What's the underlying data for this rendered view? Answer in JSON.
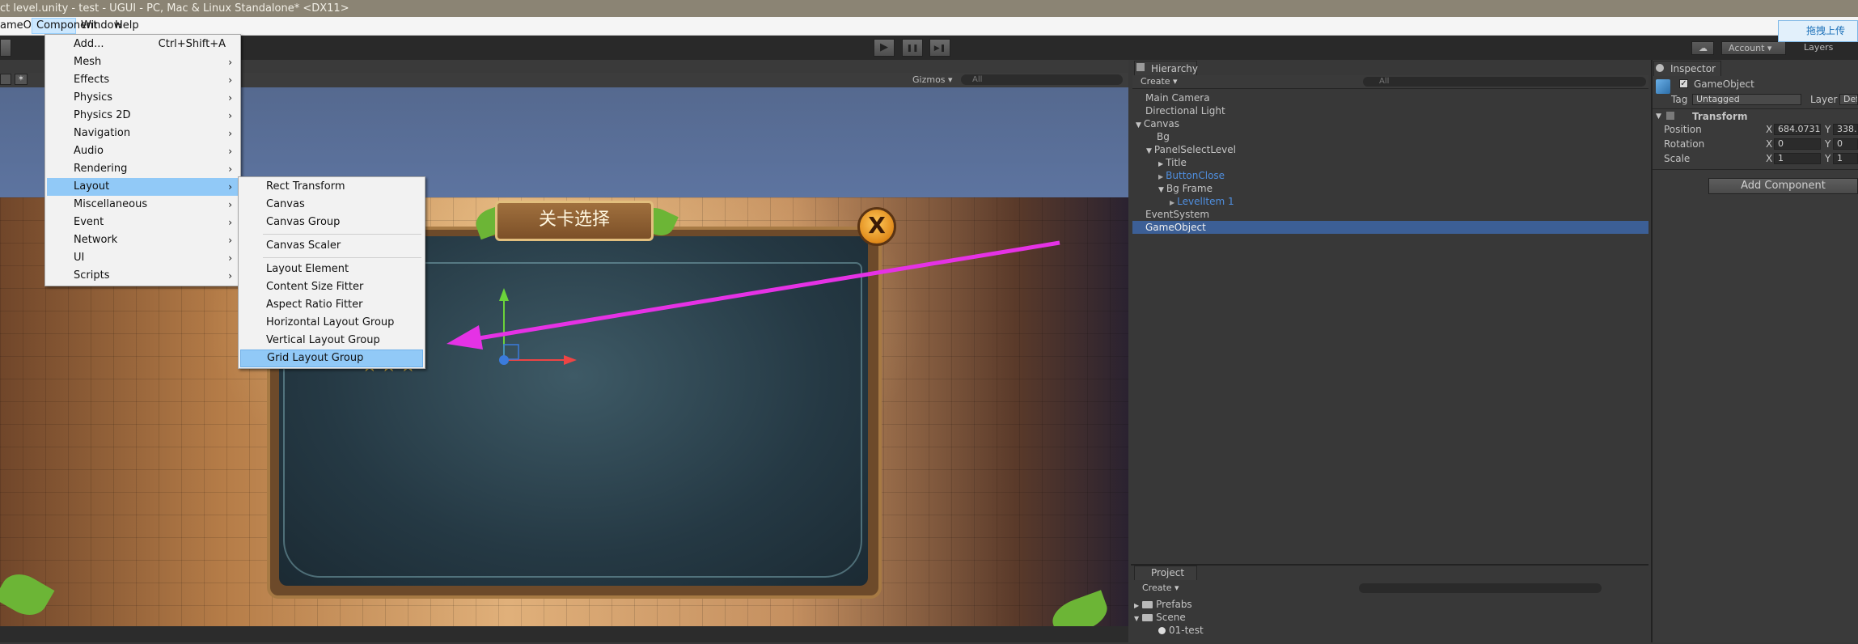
{
  "window": {
    "title": "ct level.unity - test - UGUI - PC, Mac & Linux Standalone* <DX11>"
  },
  "menubar": {
    "items": [
      "ameObject",
      "Component",
      "Window",
      "Help"
    ],
    "active": "Component"
  },
  "toolbar": {
    "play": "▶",
    "pause": "❚❚",
    "step": "▶❚",
    "account_label": "Account",
    "layers_label": "Layers",
    "upload_label": "拖拽上传",
    "upload_icon": "cloud-upload-icon"
  },
  "scene": {
    "gizmos_label": "Gizmos",
    "search_placeholder": "All",
    "panel_title": "关卡选择",
    "close_symbol": "X"
  },
  "component_menu": {
    "items": [
      {
        "label": "Add...",
        "shortcut": "Ctrl+Shift+A"
      },
      {
        "label": "Mesh",
        "arrow": "›"
      },
      {
        "label": "Effects",
        "arrow": "›"
      },
      {
        "label": "Physics",
        "arrow": "›"
      },
      {
        "label": "Physics 2D",
        "arrow": "›"
      },
      {
        "label": "Navigation",
        "arrow": "›"
      },
      {
        "label": "Audio",
        "arrow": "›"
      },
      {
        "label": "Rendering",
        "arrow": "›"
      },
      {
        "label": "Layout",
        "arrow": "›"
      },
      {
        "label": "Miscellaneous",
        "arrow": "›"
      },
      {
        "label": "Event",
        "arrow": "›"
      },
      {
        "label": "Network",
        "arrow": "›"
      },
      {
        "label": "UI",
        "arrow": "›"
      },
      {
        "label": "Scripts",
        "arrow": "›"
      }
    ],
    "highlighted": "Layout"
  },
  "layout_submenu": {
    "items": [
      "Rect Transform",
      "Canvas",
      "Canvas Group",
      "Canvas Scaler",
      "Layout Element",
      "Content Size Fitter",
      "Aspect Ratio Fitter",
      "Horizontal Layout Group",
      "Vertical Layout Group",
      "Grid Layout Group"
    ],
    "highlighted": "Grid Layout Group"
  },
  "hierarchy": {
    "tab_label": "Hierarchy",
    "create_label": "Create ▾",
    "search_placeholder": "All",
    "rows": [
      {
        "label": "Main Camera",
        "prefix": ""
      },
      {
        "label": "Directional Light",
        "prefix": ""
      },
      {
        "label": "Canvas",
        "prefix": "▼"
      },
      {
        "label": "Bg",
        "prefix": ""
      },
      {
        "label": "PanelSelectLevel",
        "prefix": "▼"
      },
      {
        "label": "Title",
        "prefix": "▶"
      },
      {
        "label": "ButtonClose",
        "prefix": "▶"
      },
      {
        "label": "Bg Frame",
        "prefix": "▼"
      },
      {
        "label": "LevelItem 1",
        "prefix": "▶"
      },
      {
        "label": "EventSystem",
        "prefix": ""
      },
      {
        "label": "GameObject",
        "prefix": ""
      }
    ],
    "selected": "GameObject"
  },
  "project": {
    "tab_label": "Project",
    "create_label": "Create ▾",
    "rows": [
      {
        "label": "Prefabs",
        "prefix": "▶"
      },
      {
        "label": "Scene",
        "prefix": "▼"
      },
      {
        "label": "01-test",
        "prefix": ""
      }
    ]
  },
  "inspector": {
    "tab_label": "Inspector",
    "object_name": "GameObject",
    "tag_label": "Tag",
    "tag_value": "Untagged",
    "layer_label": "Layer",
    "layer_value": "Def",
    "transform_label": "Transform",
    "position_label": "Position",
    "pos_x": "684.0731",
    "pos_y": "338.",
    "rotation_label": "Rotation",
    "rot_x": "0",
    "rot_y": "0",
    "scale_label": "Scale",
    "scale_x": "1",
    "scale_y": "1",
    "x_axis": "X",
    "y_axis": "Y",
    "add_component_label": "Add Component"
  },
  "colors": {
    "accent_arrow": "#e532e5",
    "selection": "#3c5f96",
    "menu_highlight": "#91c9f7"
  }
}
